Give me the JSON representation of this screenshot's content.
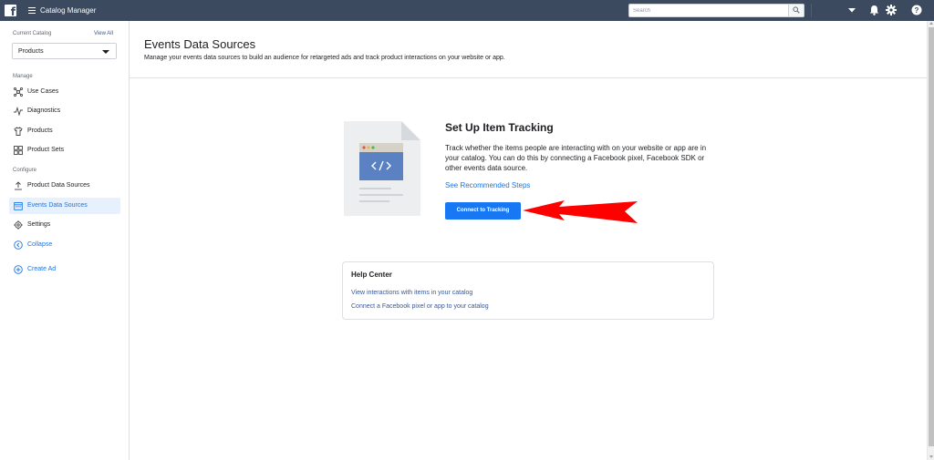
{
  "topbar": {
    "logo_letter": "f",
    "app_title": "Catalog Manager",
    "search_placeholder": "Search"
  },
  "sidebar": {
    "current_catalog_label": "Current Catalog",
    "view_all": "View All",
    "catalog_selected": "Products",
    "manage_label": "Manage",
    "manage_items": [
      {
        "label": "Use Cases",
        "icon": "use-cases-icon"
      },
      {
        "label": "Diagnostics",
        "icon": "diagnostics-icon"
      },
      {
        "label": "Products",
        "icon": "shirt-icon"
      },
      {
        "label": "Product Sets",
        "icon": "product-sets-icon"
      }
    ],
    "configure_label": "Configure",
    "configure_items": [
      {
        "label": "Product Data Sources",
        "icon": "upload-icon"
      },
      {
        "label": "Events Data Sources",
        "icon": "calendar-icon",
        "active": true
      },
      {
        "label": "Settings",
        "icon": "gear-icon"
      }
    ],
    "collapse": "Collapse",
    "create_ad": "Create Ad"
  },
  "main": {
    "title": "Events Data Sources",
    "description": "Manage your events data sources to build an audience for retargeted ads and track product interactions on your website or app.",
    "setup": {
      "title": "Set Up Item Tracking",
      "description": "Track whether the items people are interacting with on your website or app are in your catalog. You can do this by connecting a Facebook pixel, Facebook SDK or other events data source.",
      "recommended_link": "See Recommended Steps",
      "button": "Connect to Tracking"
    },
    "help_center": {
      "title": "Help Center",
      "links": [
        "View interactions with items in your catalog",
        "Connect a Facebook pixel or app to your catalog"
      ]
    }
  },
  "colors": {
    "topbar": "#3b4a5e",
    "primary_button": "#1877f2",
    "link": "#1b74e4",
    "annotation_arrow": "#ff0000"
  }
}
